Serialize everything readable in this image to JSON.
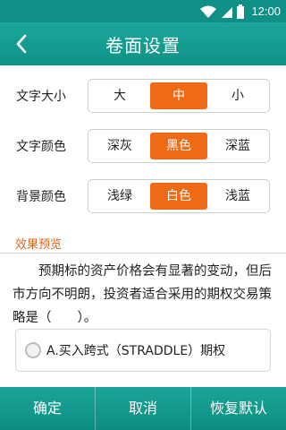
{
  "status_bar": {
    "time": "12:00",
    "icons": [
      "wifi-icon",
      "signal-icon",
      "battery-icon"
    ]
  },
  "header": {
    "title": "卷面设置",
    "back_icon": "chevron-left-icon"
  },
  "settings": {
    "font_size": {
      "label": "文字大小",
      "options": [
        "大",
        "中",
        "小"
      ],
      "selected": "中"
    },
    "font_color": {
      "label": "文字颜色",
      "options": [
        "深灰",
        "黑色",
        "深蓝"
      ],
      "selected": "黑色"
    },
    "bg_color": {
      "label": "背景颜色",
      "options": [
        "浅绿",
        "白色",
        "浅蓝"
      ],
      "selected": "白色"
    }
  },
  "preview": {
    "title": "效果预览",
    "question": "预期标的资产价格会有显著的变动，但后市方向不明朗，投资者适合采用的期权交易策略是（　　）。",
    "option_a": "A.买入跨式（STRADDLE）期权"
  },
  "bottom_bar": {
    "confirm": "确定",
    "cancel": "取消",
    "reset": "恢复默认"
  },
  "colors": {
    "primary": "#13998d",
    "accent": "#ef6a15",
    "preview_title": "#e0651b"
  }
}
